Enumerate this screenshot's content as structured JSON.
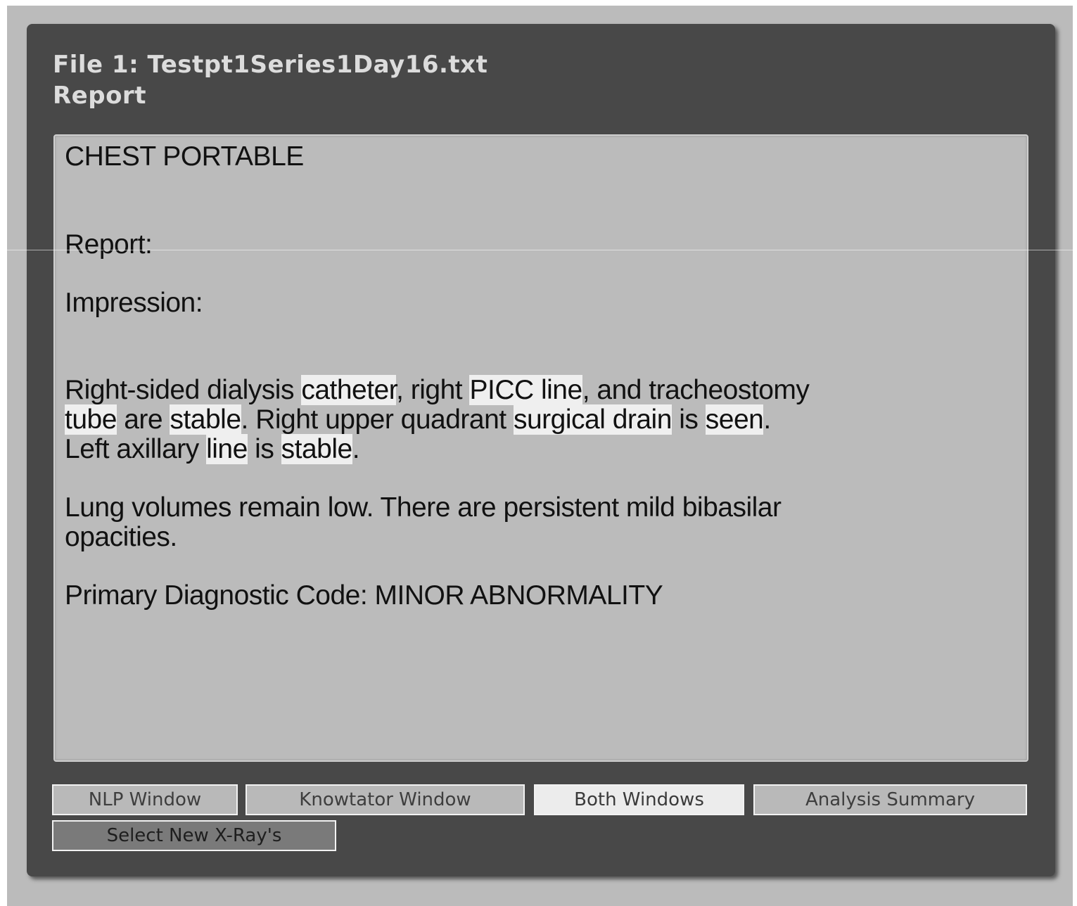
{
  "header": {
    "file_title": "File 1: Testpt1Series1Day16.txt",
    "section_title": "Report"
  },
  "report": {
    "lines": {
      "l1": "CHEST PORTABLE",
      "l2": "Report:",
      "l3": "Impression:",
      "l7": "Lung volumes remain low. There are persistent mild bibasilar",
      "l8": "opacities.",
      "l9": "Primary Diagnostic Code: MINOR ABNORMALITY"
    },
    "para1": {
      "line4": [
        {
          "t": "Right-sided dialysis ",
          "hl": false
        },
        {
          "t": "catheter",
          "hl": true
        },
        {
          "t": ", right ",
          "hl": false
        },
        {
          "t": "PICC line",
          "hl": true
        },
        {
          "t": ", and tracheostomy",
          "hl": false
        }
      ],
      "line5": [
        {
          "t": "tube",
          "hl": true
        },
        {
          "t": " are ",
          "hl": false
        },
        {
          "t": "stable",
          "hl": true
        },
        {
          "t": ". Right upper quadrant ",
          "hl": false
        },
        {
          "t": "surgical drain",
          "hl": true
        },
        {
          "t": " is ",
          "hl": false
        },
        {
          "t": "seen",
          "hl": true
        },
        {
          "t": ".",
          "hl": false
        }
      ],
      "line6": [
        {
          "t": "Left axillary ",
          "hl": false
        },
        {
          "t": "line",
          "hl": true
        },
        {
          "t": " is ",
          "hl": false
        },
        {
          "t": "stable",
          "hl": true
        },
        {
          "t": ".",
          "hl": false
        }
      ]
    }
  },
  "buttons": {
    "nlp_window": "NLP Window",
    "knowtator_window": "Knowtator Window",
    "both_windows": "Both Windows",
    "analysis_summary": "Analysis Summary",
    "select_new_xrays": "Select New X-Ray's"
  },
  "colors": {
    "panel_bg": "#484848",
    "text_area_bg": "#bbbbbb",
    "highlight": "#efefef",
    "active_button": "#ececec"
  }
}
